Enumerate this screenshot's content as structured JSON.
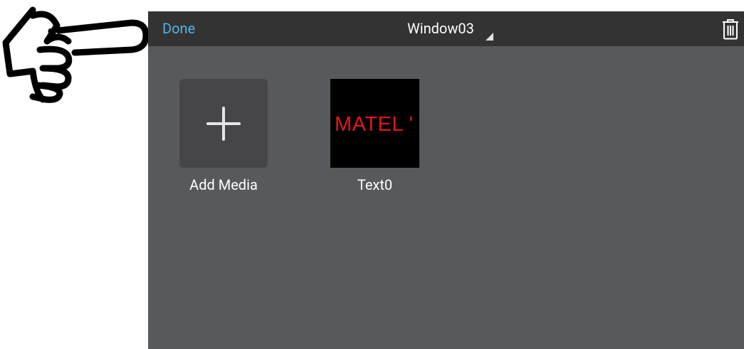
{
  "topbar": {
    "done_label": "Done",
    "window_title": "Window03"
  },
  "icons": {
    "pointer": "pointing-hand-icon",
    "trash": "trash-icon",
    "add": "plus-icon",
    "dropdown": "dropdown-caret-icon"
  },
  "media": [
    {
      "label": "Add Media"
    },
    {
      "label": "Text0",
      "preview_text": "MATEL '"
    }
  ],
  "colors": {
    "accent": "#4fb3e8",
    "topbar_bg": "#333333",
    "content_bg": "#58595d",
    "tile_bg": "#46464a",
    "preview_text": "#e01818"
  }
}
